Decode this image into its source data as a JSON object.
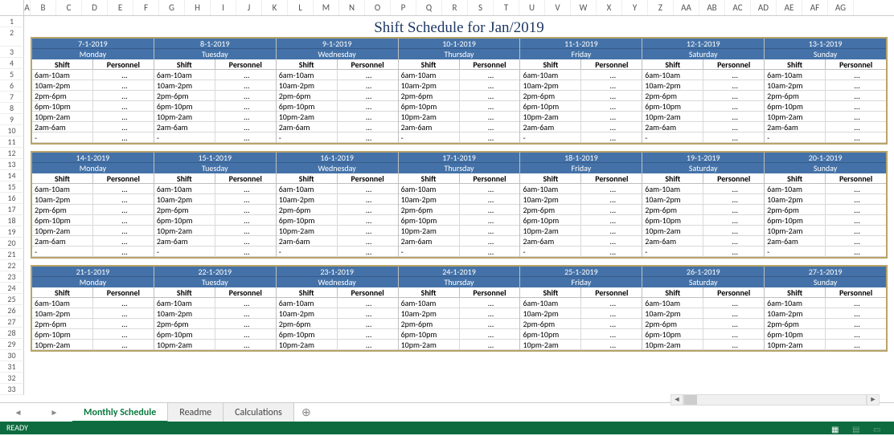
{
  "columns": [
    "A",
    "B",
    "C",
    "D",
    "E",
    "F",
    "G",
    "H",
    "I",
    "J",
    "K",
    "L",
    "M",
    "N",
    "O",
    "P",
    "Q",
    "R",
    "S",
    "T",
    "U",
    "V",
    "W",
    "X",
    "Y",
    "Z",
    "AA",
    "AB",
    "AC",
    "AD",
    "AE",
    "AF",
    "AG"
  ],
  "rows": 33,
  "title": "Shift Schedule for Jan/2019",
  "header_shift": "Shift",
  "header_personnel": "Personnel",
  "shifts": [
    "6am-10am",
    "10am-2pm",
    "2pm-6pm",
    "6pm-10pm",
    "10pm-2am",
    "2am-6am",
    "-"
  ],
  "shifts_short": [
    "6am-10am",
    "10am-2pm",
    "2pm-6pm",
    "6pm-10pm",
    "10pm-2am"
  ],
  "dots": "...",
  "weeks": [
    {
      "days": [
        [
          "7-1-2019",
          "Monday"
        ],
        [
          "8-1-2019",
          "Tuesday"
        ],
        [
          "9-1-2019",
          "Wednesday"
        ],
        [
          "10-1-2019",
          "Thursday"
        ],
        [
          "11-1-2019",
          "Friday"
        ],
        [
          "12-1-2019",
          "Saturday"
        ],
        [
          "13-1-2019",
          "Sunday"
        ]
      ]
    },
    {
      "days": [
        [
          "14-1-2019",
          "Monday"
        ],
        [
          "15-1-2019",
          "Tuesday"
        ],
        [
          "16-1-2019",
          "Wednesday"
        ],
        [
          "17-1-2019",
          "Thursday"
        ],
        [
          "18-1-2019",
          "Friday"
        ],
        [
          "19-1-2019",
          "Saturday"
        ],
        [
          "20-1-2019",
          "Sunday"
        ]
      ]
    },
    {
      "days": [
        [
          "21-1-2019",
          "Monday"
        ],
        [
          "22-1-2019",
          "Tuesday"
        ],
        [
          "23-1-2019",
          "Wednesday"
        ],
        [
          "24-1-2019",
          "Thursday"
        ],
        [
          "25-1-2019",
          "Friday"
        ],
        [
          "26-1-2019",
          "Saturday"
        ],
        [
          "27-1-2019",
          "Sunday"
        ]
      ]
    }
  ],
  "tabs": [
    {
      "label": "Monthly Schedule",
      "active": true
    },
    {
      "label": "Readme",
      "active": false
    },
    {
      "label": "Calculations",
      "active": false
    }
  ],
  "status": "READY"
}
